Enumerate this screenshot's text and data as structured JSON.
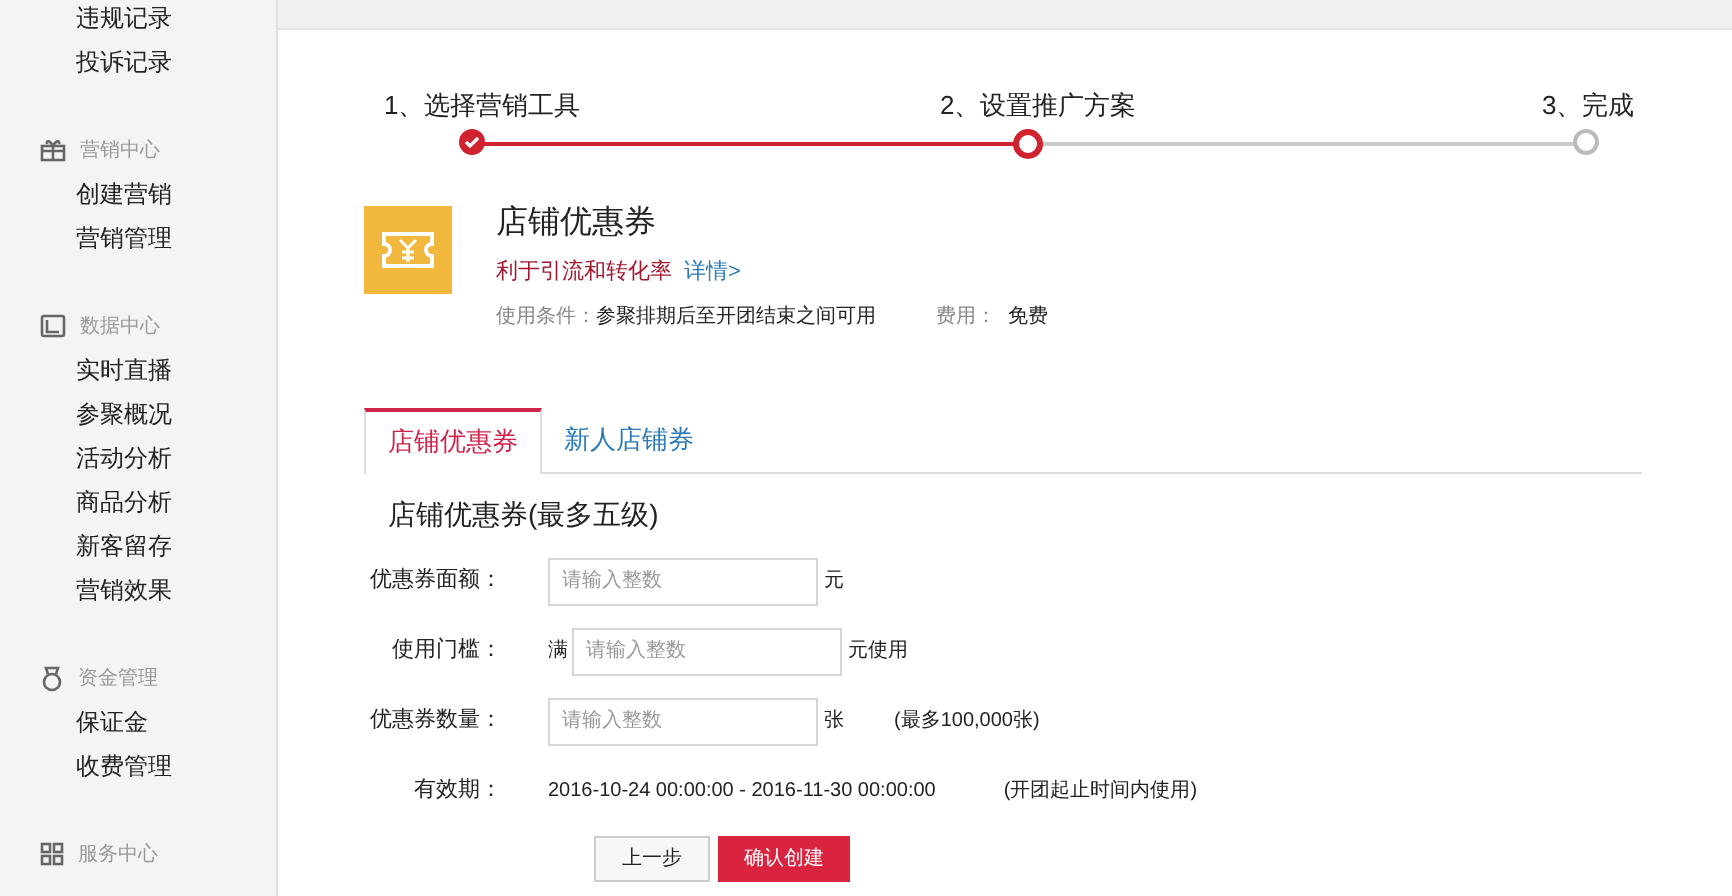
{
  "sidebar": {
    "items": [
      {
        "label": "违规记录"
      },
      {
        "label": "投诉记录"
      }
    ],
    "groups": [
      {
        "kind": "gift",
        "title": "营销中心",
        "items": [
          {
            "label": "创建营销"
          },
          {
            "label": "营销管理"
          }
        ]
      },
      {
        "kind": "chart",
        "title": "数据中心",
        "items": [
          {
            "label": "实时直播"
          },
          {
            "label": "参聚概况"
          },
          {
            "label": "活动分析"
          },
          {
            "label": "商品分析"
          },
          {
            "label": "新客留存"
          },
          {
            "label": "营销效果"
          }
        ]
      },
      {
        "kind": "money",
        "title": "资金管理",
        "items": [
          {
            "label": "保证金"
          },
          {
            "label": "收费管理"
          }
        ]
      },
      {
        "kind": "grid",
        "title": "服务中心"
      }
    ]
  },
  "steps": [
    {
      "label": "1、选择营销工具",
      "kind": "done"
    },
    {
      "label": "2、设置推广方案",
      "kind": "current"
    },
    {
      "label": "3、完成",
      "kind": "todo"
    }
  ],
  "tool": {
    "title": "店铺优惠券",
    "subtitle": "利于引流和转化率",
    "link": "详情>",
    "condition_label": "使用条件：",
    "condition": "参聚排期后至开团结束之间可用",
    "fee_label": "费用：",
    "fee": "免费"
  },
  "tabs": [
    {
      "label": "店铺优惠券",
      "selected": true
    },
    {
      "label": "新人店铺券",
      "selected": false
    }
  ],
  "form": {
    "title": "店铺优惠券(最多五级)",
    "rows": [
      {
        "kind": "input",
        "label": "优惠券面额：",
        "placeholder": "请输入整数",
        "suffix": "元"
      },
      {
        "kind": "input",
        "label": "使用门槛：",
        "prefix": "满",
        "placeholder": "请输入整数",
        "suffix": "元使用"
      },
      {
        "kind": "input",
        "label": "优惠券数量：",
        "placeholder": "请输入整数",
        "suffix": "张",
        "note": "(最多100,000张)"
      },
      {
        "kind": "text",
        "label": "有效期：",
        "value": "2016-10-24 00:00:00 - 2016-11-30 00:00:00",
        "note": "(开团起止时间内使用)"
      }
    ]
  },
  "buttons": [
    {
      "label": "上一步",
      "kind": "secondary"
    },
    {
      "label": "确认创建",
      "kind": "primary"
    }
  ]
}
